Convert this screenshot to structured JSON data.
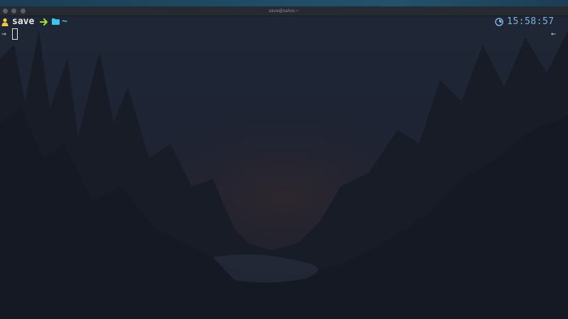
{
  "window": {
    "title": "save@salvo:~"
  },
  "prompt": {
    "user_icon": "person-icon",
    "username": "save",
    "separator_icon": "arrow-right-icon",
    "folder_icon": "folder-icon",
    "cwd": "~",
    "clock_icon": "clock-icon",
    "time": "15:58:57"
  },
  "input": {
    "left_prompt": "→",
    "right_prompt": "←",
    "value": ""
  },
  "colors": {
    "username": "#e8e8e8",
    "cwd": "#3bc8e8",
    "arrow": "#a6e22e",
    "user_icon": "#f5c542",
    "clock": "#7fb4e0",
    "background": "#1e2433"
  }
}
